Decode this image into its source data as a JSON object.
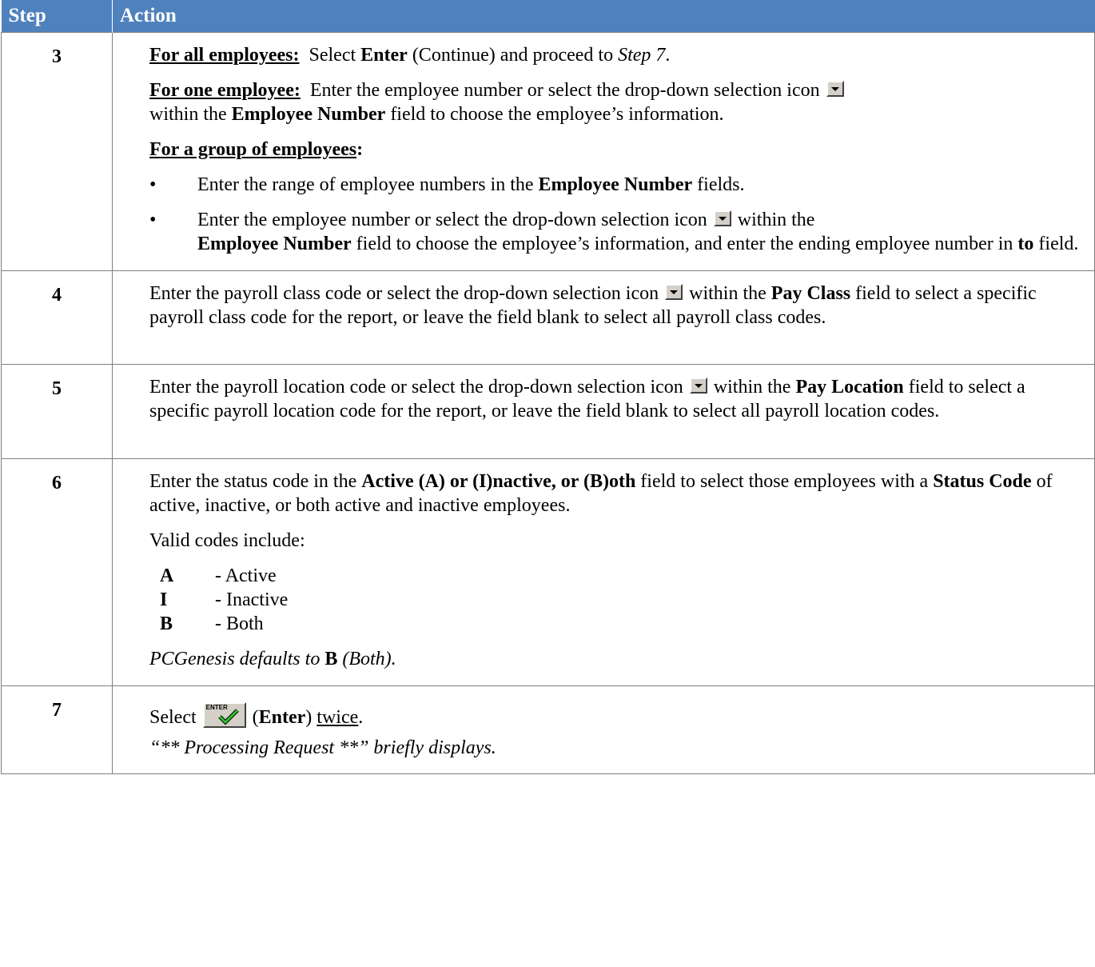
{
  "header": {
    "step": "Step",
    "action": "Action"
  },
  "rows": [
    {
      "step": "3",
      "all_label": "For all employees:",
      "all_text_1": "  Select ",
      "all_enter": "Enter",
      "all_text_2": " (Continue) and proceed to ",
      "all_step_ref": "Step 7",
      "all_text_3": ".",
      "one_label": "For one employee:",
      "one_text_1": "  Enter the employee number or select the drop-down selection icon ",
      "one_text_2": " within the ",
      "one_field": "Employee Number",
      "one_text_3": " field to choose the employee’s information.",
      "group_label": "For a group of employees",
      "group_colon": ":",
      "bullet_1_text_1": "Enter the range of employee numbers in the ",
      "bullet_1_field": "Employee Number",
      "bullet_1_text_2": " fields.",
      "bullet_2_text_1": "Enter the employee number or select the drop-down selection icon ",
      "bullet_2_text_2": " within the ",
      "bullet_2_field": "Employee Number",
      "bullet_2_text_3": " field to choose the employee’s information, and enter the ending employee number in ",
      "bullet_2_to": "to",
      "bullet_2_text_4": " field."
    },
    {
      "step": "4",
      "text_1": "Enter the payroll class code or select the drop-down selection icon ",
      "text_2": " within the ",
      "field": "Pay Class",
      "text_3": " field to select a specific payroll class code for the report, or leave the field blank to select all payroll class codes."
    },
    {
      "step": "5",
      "text_1": "Enter the payroll location code or select the drop-down selection icon ",
      "text_2": " within the ",
      "field": "Pay Location",
      "text_3": " field to select a specific payroll location code for the report, or leave the field blank to select all payroll location codes."
    },
    {
      "step": "6",
      "text_1": "Enter the status code in the ",
      "field": "Active (A) or (I)nactive, or (B)oth",
      "text_2": " field to select those employees with a ",
      "status": "Status Code",
      "text_3": " of active, inactive, or both active and inactive employees.",
      "valid": "Valid codes include:",
      "codes": [
        {
          "code": "A",
          "desc": "- Active"
        },
        {
          "code": "I",
          "desc": "- Inactive"
        },
        {
          "code": "B",
          "desc": "- Both"
        }
      ],
      "default_text": "PCGenesis defaults to ",
      "default_code": "B",
      "default_paren": " (Both)."
    },
    {
      "step": "7",
      "select": "Select ",
      "enter_icon_text": "ENTER",
      "paren_open": " (",
      "enter": "Enter",
      "paren_close": ") ",
      "twice": "twice",
      "period": ".",
      "processing": "“** Processing Request **” briefly displays."
    }
  ],
  "bullet_glyph": "•",
  "icons": {
    "dropdown": "dropdown-arrow-icon",
    "enter": "enter-check-icon"
  },
  "colors": {
    "header_bg": "#4f81bd",
    "header_text": "#ffffff"
  }
}
